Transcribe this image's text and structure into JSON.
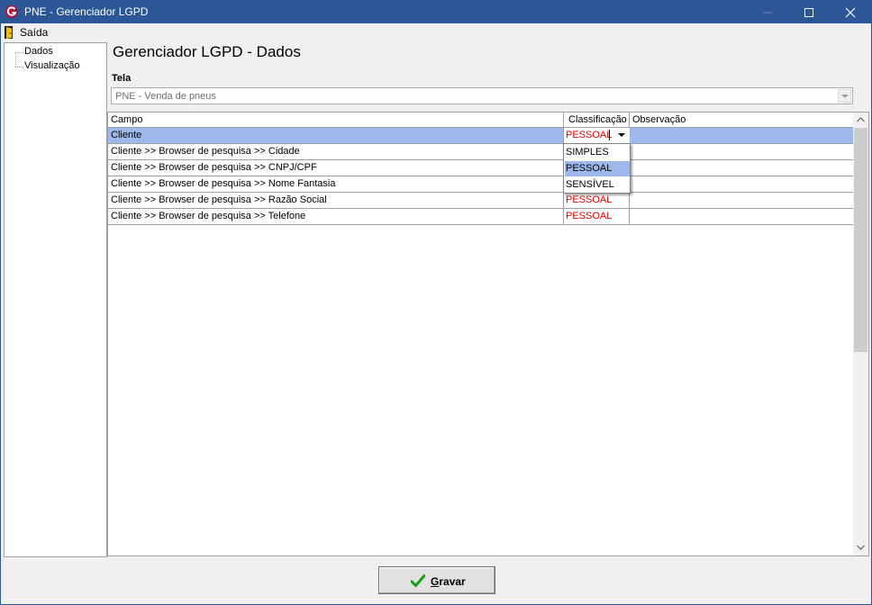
{
  "window": {
    "title": "PNE - Gerenciador LGPD",
    "controls": [
      "minimize",
      "maximize",
      "close"
    ]
  },
  "menu": {
    "items": [
      {
        "label": "Saída",
        "icon": "exit-door-icon"
      }
    ]
  },
  "tree": {
    "items": [
      {
        "label": "Dados"
      },
      {
        "label": "Visualização"
      }
    ]
  },
  "page": {
    "title": "Gerenciador LGPD - Dados",
    "tela_label": "Tela",
    "tela_value": "PNE - Venda de pneus"
  },
  "grid": {
    "columns": [
      "Campo",
      "Classificação",
      "Observação"
    ],
    "rows": [
      {
        "campo": "Cliente",
        "classificacao": "PESSOAL",
        "observacao": ""
      },
      {
        "campo": "Cliente >> Browser de pesquisa >> Cidade",
        "classificacao": "",
        "observacao": ""
      },
      {
        "campo": "Cliente >> Browser de pesquisa >> CNPJ/CPF",
        "classificacao": "",
        "observacao": ""
      },
      {
        "campo": "Cliente >> Browser de pesquisa >> Nome Fantasia",
        "classificacao": "",
        "observacao": ""
      },
      {
        "campo": "Cliente >> Browser de pesquisa >> Razão Social",
        "classificacao": "PESSOAL",
        "observacao": ""
      },
      {
        "campo": "Cliente >> Browser de pesquisa >> Telefone",
        "classificacao": "PESSOAL",
        "observacao": ""
      }
    ],
    "selected_row": 0,
    "editor_value": "PESSOAL",
    "dropdown_options": [
      "SIMPLES",
      "PESSOAL",
      "SENSÍVEL"
    ],
    "dropdown_highlighted": "PESSOAL"
  },
  "footer": {
    "save_button": {
      "label_underlined": "G",
      "label_rest": "ravar",
      "icon": "checkmark-icon"
    }
  },
  "colors": {
    "titlebar": "#2b5797",
    "selection": "#9db9eb",
    "classification_text": "#e00000",
    "checkmark": "#1a9a1a"
  }
}
